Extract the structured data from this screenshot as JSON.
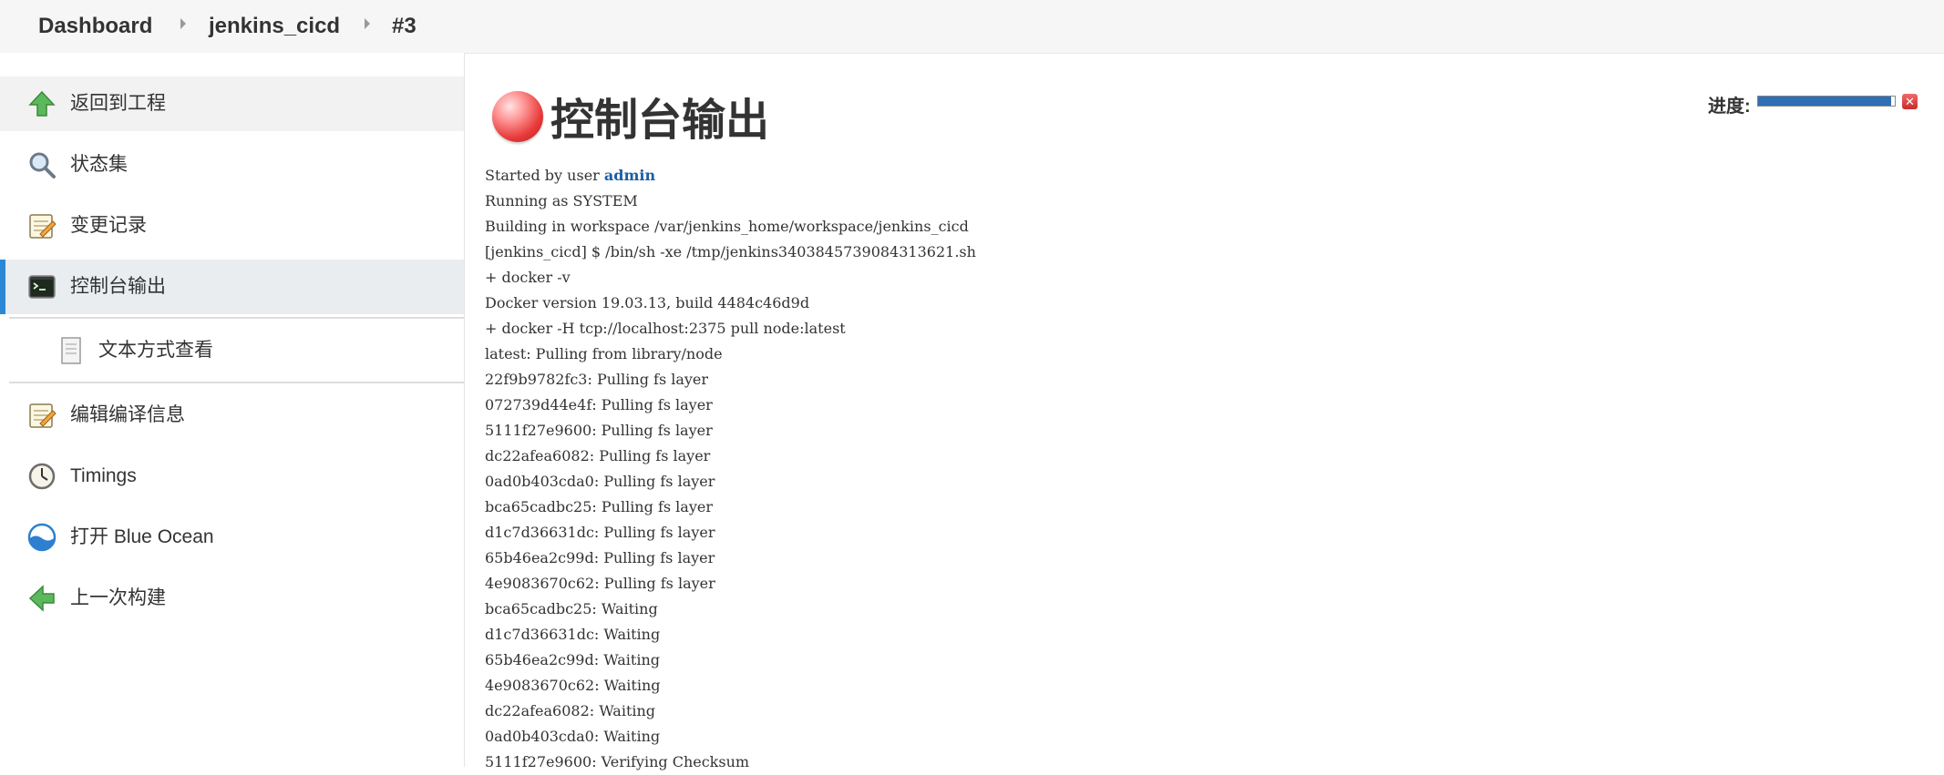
{
  "breadcrumb": {
    "items": [
      {
        "label": "Dashboard"
      },
      {
        "label": "jenkins_cicd"
      },
      {
        "label": "#3"
      }
    ]
  },
  "sidebar": {
    "items": [
      {
        "label": "返回到工程",
        "icon": "up-arrow-icon"
      },
      {
        "label": "状态集",
        "icon": "magnifier-icon"
      },
      {
        "label": "变更记录",
        "icon": "notepad-icon"
      },
      {
        "label": "控制台输出",
        "icon": "terminal-icon"
      },
      {
        "label": "文本方式查看",
        "icon": "document-icon"
      },
      {
        "label": "编辑编译信息",
        "icon": "notepad-icon"
      },
      {
        "label": "Timings",
        "icon": "clock-icon"
      },
      {
        "label": "打开 Blue Ocean",
        "icon": "blue-ocean-icon"
      },
      {
        "label": "上一次构建",
        "icon": "left-arrow-icon"
      }
    ]
  },
  "main": {
    "title": "控制台输出",
    "status": "failed",
    "progress": {
      "label": "进度:",
      "value": 0.97
    },
    "console": {
      "started_prefix": "Started by user ",
      "started_user": "admin",
      "lines": [
        "Running as SYSTEM",
        "Building in workspace /var/jenkins_home/workspace/jenkins_cicd",
        "[jenkins_cicd] $ /bin/sh -xe /tmp/jenkins3403845739084313621.sh",
        "+ docker -v",
        "Docker version 19.03.13, build 4484c46d9d",
        "+ docker -H tcp://localhost:2375 pull node:latest",
        "latest: Pulling from library/node",
        "22f9b9782fc3: Pulling fs layer",
        "072739d44e4f: Pulling fs layer",
        "5111f27e9600: Pulling fs layer",
        "dc22afea6082: Pulling fs layer",
        "0ad0b403cda0: Pulling fs layer",
        "bca65cadbc25: Pulling fs layer",
        "d1c7d36631dc: Pulling fs layer",
        "65b46ea2c99d: Pulling fs layer",
        "4e9083670c62: Pulling fs layer",
        "bca65cadbc25: Waiting",
        "d1c7d36631dc: Waiting",
        "65b46ea2c99d: Waiting",
        "4e9083670c62: Waiting",
        "dc22afea6082: Waiting",
        "0ad0b403cda0: Waiting",
        "5111f27e9600: Verifying Checksum"
      ]
    }
  },
  "colors": {
    "accent": "#2c87d4",
    "status_red": "#e83a3a",
    "progress": "#2f6fb3",
    "link": "#1b5fa3"
  }
}
